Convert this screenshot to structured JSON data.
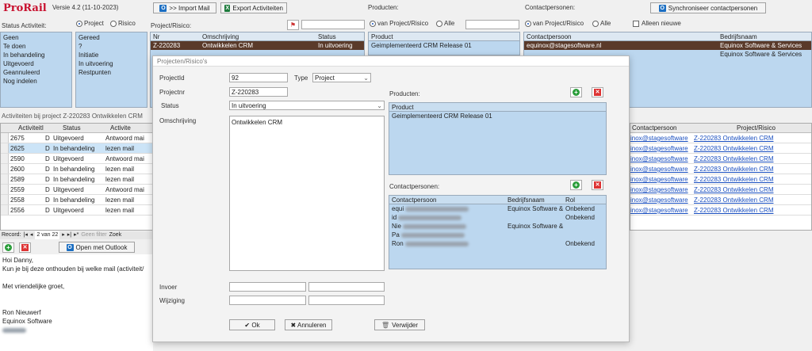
{
  "app": {
    "logo": "ProRail",
    "version": "Versie 4.2 (11-10-2023)",
    "import_mail": ">> Import Mail",
    "export_activiteiten": "Export Activiteiten",
    "producten_label": "Producten:",
    "contactpersonen_label": "Contactpersonen:",
    "sync_contactpersonen": "Synchroniseer contactpersonen"
  },
  "filters": {
    "status_label": "Status Activiteit:",
    "status_items": [
      "Geen",
      "Te doen",
      "In behandeling",
      "Uitgevoerd",
      "Geannuleerd",
      "Nog indelen"
    ],
    "radio_project": "Project",
    "radio_risico": "Risico",
    "project_status_items": [
      "Gereed",
      "?",
      "Initiatie",
      "In uitvoering",
      "Restpunten"
    ],
    "project_risico_label": "Project/Risico:",
    "project_grid": {
      "headers": [
        "Nr",
        "Omschrijving",
        "Status"
      ],
      "rows": [
        [
          "Z-220283",
          "Ontwikkelen CRM",
          "In uitvoering"
        ]
      ]
    },
    "producten_radio_project": "van Project/Risico",
    "producten_radio_alle": "Alle",
    "producten_grid": {
      "header": "Product",
      "rows": [
        "Geimplementeerd CRM Release 01"
      ]
    },
    "contact_radio_project": "van Project/Risico",
    "contact_radio_alle": "Alle",
    "alleen_nieuwe": "Alleen nieuwe",
    "contact_grid": {
      "headers": [
        "Contactpersoon",
        "Bedrijfsnaam"
      ],
      "rows": [
        [
          "equinox@stagesoftware.nl",
          "Equinox Software & Services"
        ],
        [
          "",
          "Equinox Software & Services"
        ]
      ]
    }
  },
  "activities": {
    "title": "Activiteiten bij project Z-220283 Ontwikkelen CRM",
    "headers": [
      "ActiviteitI",
      "Status",
      "Activite"
    ],
    "rows": [
      {
        "id": "2675",
        "flag": "D",
        "status": "Uitgevoerd",
        "act": "Antwoord mai"
      },
      {
        "id": "2625",
        "flag": "D",
        "status": "In behandeling",
        "act": "lezen mail"
      },
      {
        "id": "2590",
        "flag": "D",
        "status": "Uitgevoerd",
        "act": "Antwoord mai"
      },
      {
        "id": "2600",
        "flag": "D",
        "status": "In behandeling",
        "act": "lezen mail"
      },
      {
        "id": "2589",
        "flag": "D",
        "status": "In behandeling",
        "act": "lezen mail"
      },
      {
        "id": "2559",
        "flag": "D",
        "status": "Uitgevoerd",
        "act": "Antwoord mai"
      },
      {
        "id": "2558",
        "flag": "D",
        "status": "In behandeling",
        "act": "lezen mail"
      },
      {
        "id": "2556",
        "flag": "D",
        "status": "Uitgevoerd",
        "act": "lezen mail"
      }
    ],
    "right_headers": [
      "Contactpersoon",
      "Project/Risico"
    ],
    "right_rows": [
      [
        "inox@stagesoftware",
        "Z-220283 Ontwikkelen CRM"
      ],
      [
        "inox@stagesoftware",
        "Z-220283 Ontwikkelen CRM"
      ],
      [
        "inox@stagesoftware",
        "Z-220283 Ontwikkelen CRM"
      ],
      [
        "inox@stagesoftware",
        "Z-220283 Ontwikkelen CRM"
      ],
      [
        "inox@stagesoftware",
        "Z-220283 Ontwikkelen CRM"
      ],
      [
        "inox@stagesoftware",
        "Z-220283 Ontwikkelen CRM"
      ],
      [
        "inox@stagesoftware",
        "Z-220283 Ontwikkelen CRM"
      ],
      [
        "inox@stagesoftware",
        "Z-220283 Ontwikkelen CRM"
      ]
    ],
    "nav_record": "Record:",
    "nav_pos": "2 van 22",
    "nav_filter": "Geen filter",
    "nav_zoek": "Zoek"
  },
  "mail": {
    "open_outlook": "Open met Outlook",
    "lines": [
      "Hoi Danny,",
      "Kun je bij deze onthouden bij welke mail (activiteit/",
      "",
      "Met vriendelijke groet,",
      "",
      "",
      "Ron Nieuwerf",
      "Equinox Software"
    ]
  },
  "modal": {
    "title": "Projecten/Risico's",
    "projectid_label": "ProjectId",
    "projectid_value": "92",
    "type_label": "Type",
    "type_value": "Project",
    "projectnr_label": "Projectnr",
    "projectnr_value": "Z-220283",
    "status_label": "Status",
    "status_value": "In uitvoering",
    "omschrijving_label": "Omschrijving",
    "omschrijving_value": "Ontwikkelen CRM",
    "producten_label": "Producten:",
    "product_header": "Product",
    "product_rows": [
      "Geimplementeerd CRM Release 01"
    ],
    "contactpersonen_label": "Contactpersonen:",
    "cp_headers": [
      "Contactpersoon",
      "Bedrijfsnaam",
      "Rol"
    ],
    "cp_rows": [
      {
        "name": "equi",
        "company": "Equinox Software &",
        "rol": "Onbekend"
      },
      {
        "name": "id",
        "company": "",
        "rol": "Onbekend"
      },
      {
        "name": "Nie",
        "company": "Equinox Software &",
        "rol": ""
      },
      {
        "name": "Pa",
        "company": "",
        "rol": ""
      },
      {
        "name": "Ron",
        "company": "",
        "rol": "Onbekend"
      }
    ],
    "invoer_label": "Invoer",
    "wijziging_label": "Wijziging",
    "ok": "✔ Ok",
    "annuleren": "✖ Annuleren",
    "verwijder": "Verwijder"
  }
}
